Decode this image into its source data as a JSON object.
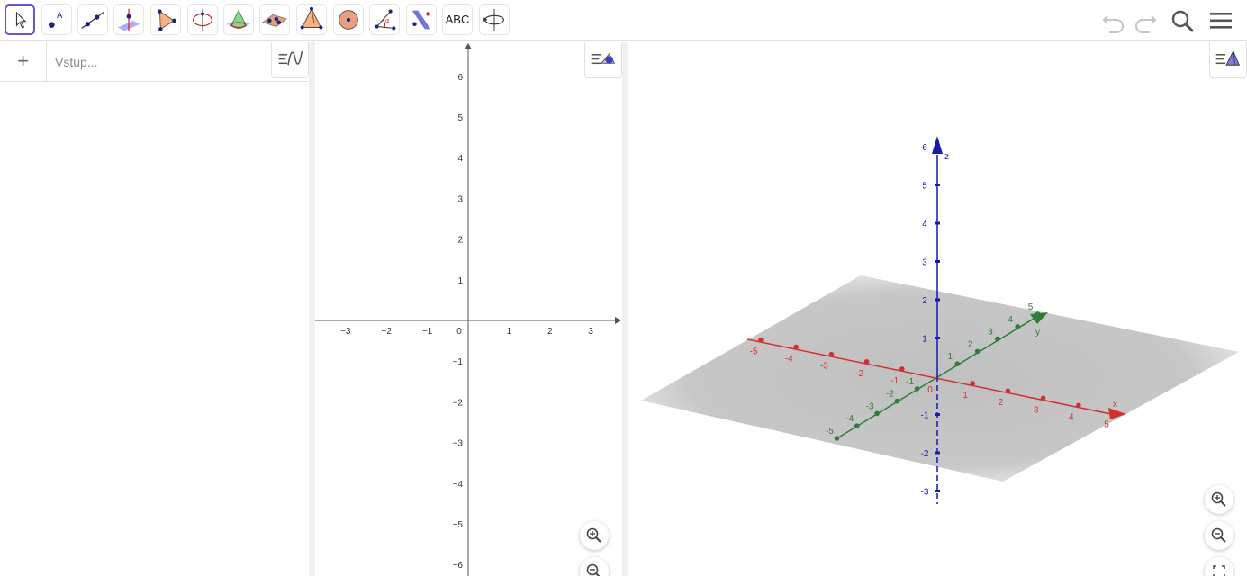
{
  "toolbar": {
    "tools": [
      {
        "id": "move",
        "icon": "arrow-cursor-icon"
      },
      {
        "id": "point",
        "icon": "point-icon"
      },
      {
        "id": "line",
        "icon": "line-icon"
      },
      {
        "id": "perpendicular",
        "icon": "perpendicular-line-icon"
      },
      {
        "id": "polygon",
        "icon": "polygon-icon"
      },
      {
        "id": "circle-axis",
        "icon": "circle-around-axis-icon"
      },
      {
        "id": "intersect-surfaces",
        "icon": "intersect-surfaces-icon"
      },
      {
        "id": "plane-points",
        "icon": "plane-through-points-icon"
      },
      {
        "id": "pyramid",
        "icon": "pyramid-icon"
      },
      {
        "id": "sphere",
        "icon": "sphere-icon"
      },
      {
        "id": "angle",
        "icon": "angle-icon"
      },
      {
        "id": "reflect-plane",
        "icon": "reflect-about-plane-icon"
      },
      {
        "id": "text",
        "icon": "text-icon",
        "label": "ABC"
      },
      {
        "id": "rotate-view",
        "icon": "rotate-view-icon"
      }
    ],
    "undo_icon": "undo-icon",
    "redo_icon": "redo-icon",
    "search_icon": "search-icon",
    "menu_icon": "menu-icon"
  },
  "algebra": {
    "add_icon": "plus-icon",
    "add_label": "+",
    "input_placeholder": "Vstup...",
    "settings_icon": "algebra-settings-icon"
  },
  "colors": {
    "accent": "#6557d2",
    "x_axis": "#d32f2f",
    "y_axis": "#2e7d32",
    "z_axis": "#1a1aa8",
    "axis2d": "#555555"
  },
  "view2d": {
    "x_ticks": [
      "−3",
      "−2",
      "−1",
      "0",
      "1",
      "2",
      "3"
    ],
    "y_ticks_pos": [
      "1",
      "2",
      "3",
      "4",
      "5",
      "6"
    ],
    "y_ticks_neg": [
      "−1",
      "−2",
      "−3",
      "−4",
      "−5",
      "−6"
    ],
    "zoom_in_icon": "zoom-in-icon",
    "zoom_out_icon": "zoom-out-icon",
    "settings_icon": "graphics-settings-icon"
  },
  "view3d": {
    "axis_labels": {
      "x": "x",
      "y": "y",
      "z": "z"
    },
    "x_ticks": [
      "-5",
      "-4",
      "-3",
      "-2",
      "-1",
      "1",
      "2",
      "3",
      "4",
      "5"
    ],
    "y_ticks": [
      "-5",
      "-4",
      "-3",
      "-2",
      "-1",
      "1",
      "2",
      "3",
      "4",
      "5"
    ],
    "z_ticks": [
      "-3",
      "-2",
      "-1",
      "1",
      "2",
      "3",
      "4",
      "5",
      "6"
    ],
    "origin_label": "0",
    "zoom_in_icon": "zoom-in-icon",
    "zoom_out_icon": "zoom-out-icon",
    "fullscreen_icon": "fullscreen-icon",
    "settings_icon": "view-3d-settings-icon"
  }
}
